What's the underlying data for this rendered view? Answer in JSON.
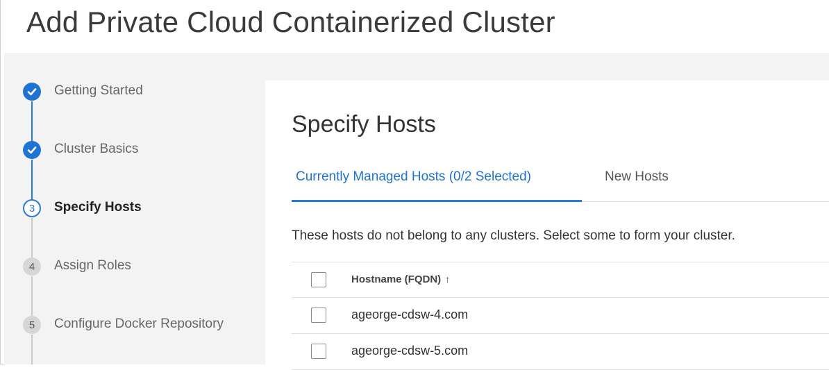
{
  "page": {
    "title": "Add Private Cloud Containerized Cluster"
  },
  "wizard": {
    "steps": [
      {
        "number": "",
        "label": "Getting Started",
        "state": "done"
      },
      {
        "number": "",
        "label": "Cluster Basics",
        "state": "done"
      },
      {
        "number": "3",
        "label": "Specify Hosts",
        "state": "active"
      },
      {
        "number": "4",
        "label": "Assign Roles",
        "state": "todo"
      },
      {
        "number": "5",
        "label": "Configure Docker Repository",
        "state": "todo"
      }
    ]
  },
  "main": {
    "section_title": "Specify Hosts",
    "tabs": [
      {
        "label": "Currently Managed Hosts (0/2 Selected)",
        "active": true
      },
      {
        "label": "New Hosts",
        "active": false
      }
    ],
    "description": "These hosts do not belong to any clusters. Select some to form your cluster.",
    "table": {
      "header": {
        "hostname": "Hostname (FQDN)",
        "sort_icon": "↑"
      },
      "rows": [
        {
          "hostname": "ageorge-cdsw-4.com",
          "checked": false
        },
        {
          "hostname": "ageorge-cdsw-5.com",
          "checked": false
        }
      ]
    }
  },
  "colors": {
    "accent": "#1f73d3",
    "panel_bg": "#f3f3f3"
  }
}
